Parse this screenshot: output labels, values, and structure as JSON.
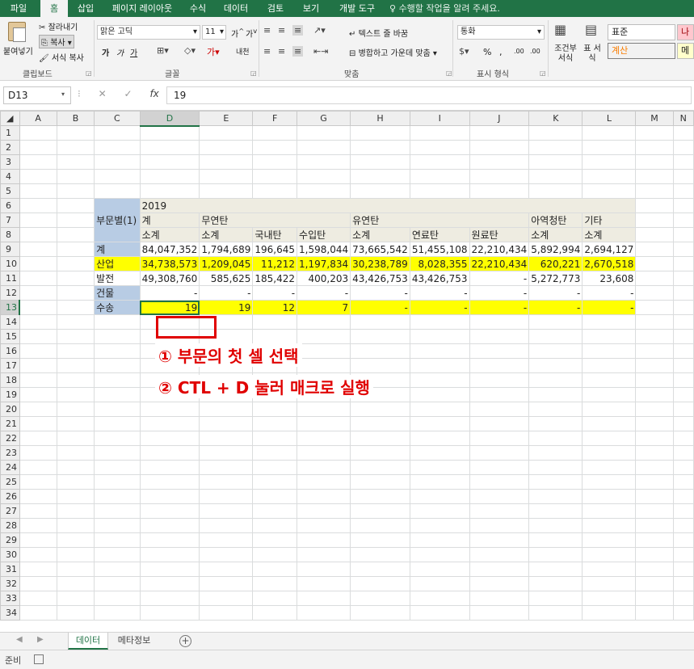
{
  "ribbon_tabs": [
    "파일",
    "홈",
    "삽입",
    "페이지 레이아웃",
    "수식",
    "데이터",
    "검토",
    "보기",
    "개발 도구"
  ],
  "active_tab": "홈",
  "tell_me": "수행할 작업을 알려 주세요.",
  "clipboard": {
    "paste": "붙여넣기",
    "cut": "잘라내기",
    "copy": "복사",
    "format_painter": "서식 복사",
    "label": "클립보드"
  },
  "font": {
    "name": "맑은 고딕",
    "size": "11",
    "bold": "가",
    "italic": "가",
    "underline": "가",
    "grow": "가",
    "shrink": "가",
    "phonetic": "내천",
    "label": "글꼴"
  },
  "alignment": {
    "wrap_text": "텍스트 줄 바꿈",
    "merge_center": "병합하고 가운데 맞춤",
    "label": "맞춤"
  },
  "number": {
    "format": "통화",
    "percent": "%",
    "comma": ",",
    "inc_decimal": ".00",
    "dec_decimal": ".00",
    "label": "표시 형식"
  },
  "styles": {
    "conditional": "조건부 서식",
    "table": "표 서식",
    "normal": "표준",
    "bad": "나",
    "calc": "계산",
    "check": "메"
  },
  "formula_bar": {
    "name_box": "D13",
    "cancel": "✕",
    "enter": "✓",
    "fx": "fx",
    "value": "19"
  },
  "columns": [
    "A",
    "B",
    "C",
    "D",
    "E",
    "F",
    "G",
    "H",
    "I",
    "J",
    "K",
    "L",
    "M",
    "N"
  ],
  "rows": [
    "1",
    "2",
    "3",
    "4",
    "5",
    "6",
    "7",
    "8",
    "9",
    "10",
    "11",
    "12",
    "13",
    "14",
    "15",
    "16",
    "17",
    "18",
    "19",
    "20",
    "21",
    "22",
    "23",
    "24",
    "25",
    "26",
    "27",
    "28",
    "29",
    "30",
    "31",
    "32",
    "33",
    "34"
  ],
  "table": {
    "row_header_label": "부문별(1)",
    "year": "2019",
    "groups": {
      "total": "계",
      "smokeless": "무연탄",
      "bituminous": "유연탄",
      "anthracite": "아역청탄",
      "other": "기타"
    },
    "subheaders": {
      "subtotal": "소계",
      "domestic": "국내탄",
      "imported": "수입탄",
      "fuel": "연료탄",
      "raw": "원료탄"
    },
    "data_rows": [
      {
        "label": "계",
        "values": [
          "84,047,352",
          "1,794,689",
          "196,645",
          "1,598,044",
          "73,665,542",
          "51,455,108",
          "22,210,434",
          "5,892,994",
          "2,694,127"
        ]
      },
      {
        "label": "산업",
        "values": [
          "34,738,573",
          "1,209,045",
          "11,212",
          "1,197,834",
          "30,238,789",
          "8,028,355",
          "22,210,434",
          "620,221",
          "2,670,518"
        ]
      },
      {
        "label": "발전",
        "values": [
          "49,308,760",
          "585,625",
          "185,422",
          "400,203",
          "43,426,753",
          "43,426,753",
          "-",
          "5,272,773",
          "23,608"
        ]
      },
      {
        "label": "건물",
        "values": [
          "-",
          "-",
          "-",
          "-",
          "-",
          "-",
          "-",
          "-",
          "-"
        ]
      },
      {
        "label": "수송",
        "values": [
          "19",
          "19",
          "12",
          "7",
          "-",
          "-",
          "-",
          "-",
          "-"
        ]
      }
    ]
  },
  "annotations": {
    "step1": "① 부문의 첫 셀 선택",
    "step2": "② CTL + D 눌러 매크로 실행"
  },
  "sheet_tabs": [
    "데이터",
    "메타정보"
  ],
  "active_sheet": "데이터",
  "status": "준비",
  "colors": {
    "excel_green": "#217346",
    "highlight_yellow": "#ffff00",
    "header_blue": "#b8cce4",
    "header_beige": "#eeece1",
    "annotation_red": "#e00000"
  }
}
